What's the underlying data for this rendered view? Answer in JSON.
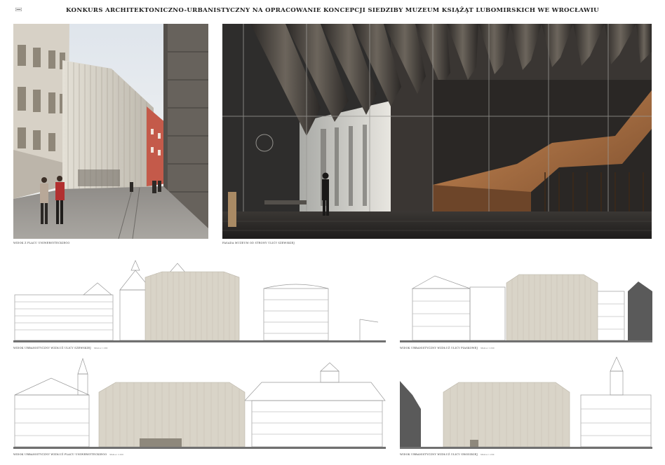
{
  "board": {
    "title": "KONKURS ARCHITEKTONICZNO-URBANISTYCZNY NA OPRACOWANIE KONCEPCJI SIEDZIBY MUZEUM KSIĄŻĄT LUBOMIRSKICH WE WROCŁAWIU"
  },
  "views": {
    "street_view": {
      "caption": "WIDOK Z PLACU UNIWERSYTECKIEGO"
    },
    "facade_view": {
      "caption": "FASADA MUZEUM OD STRONY ULICY SZEWSKIEJ"
    }
  },
  "elevations": [
    {
      "caption": "WIDOK URBANISTYCZNY WZDŁUŻ ULICY SZEWSKIEJ",
      "scale": "SKALA 1:200"
    },
    {
      "caption": "WIDOK URBANISTYCZNY WZDŁUŻ ULICY PIASKOWEJ",
      "scale": "SKALA 1:200"
    },
    {
      "caption": "WIDOK URBANISTYCZNY WZDŁUŻ PLACU UNIWERSYTECKIEGO",
      "scale": "SKALA 1:200"
    },
    {
      "caption": "WIDOK URBANISTYCZNY WZDŁUŻ ULICY GRODZKIEJ",
      "scale": "SKALA 1:200"
    }
  ],
  "colors": {
    "museum_fill": "#d9d4c8",
    "stone_dark": "#3a3633",
    "sky": "#eef0f2",
    "stair_bronze": "#b0754a"
  }
}
